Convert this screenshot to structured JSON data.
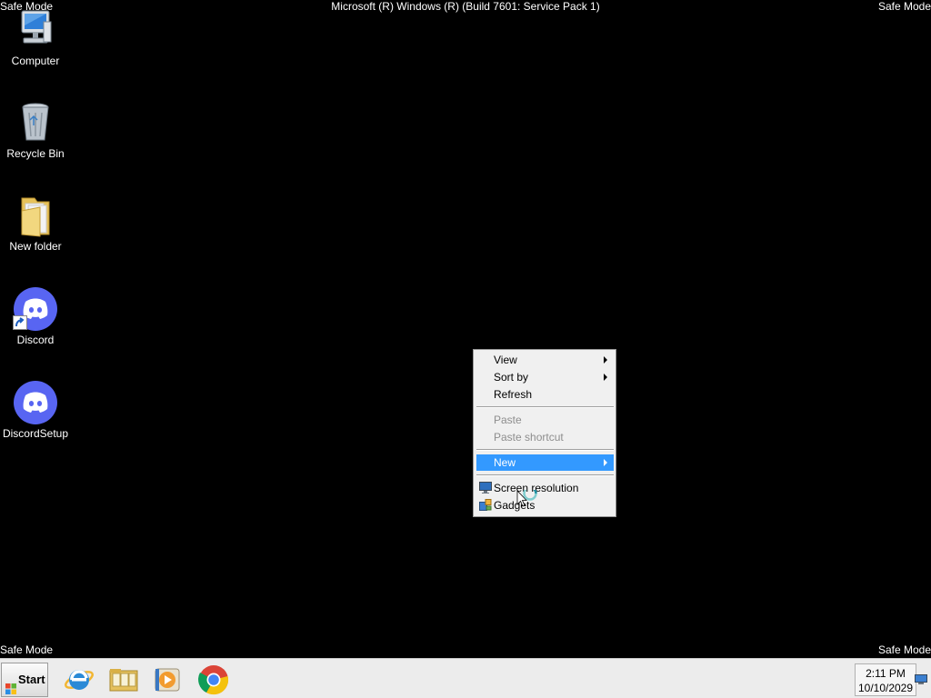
{
  "screen": {
    "safe_mode_labels": [
      "Safe Mode",
      "Safe Mode",
      "Safe Mode",
      "Safe Mode"
    ],
    "build_text": "Microsoft (R) Windows (R) (Build 7601: Service Pack 1)"
  },
  "desktop": {
    "icons": [
      {
        "label": "Computer",
        "icon": "computer-icon"
      },
      {
        "label": "Recycle Bin",
        "icon": "recycle-bin-icon"
      },
      {
        "label": "New folder",
        "icon": "folder-icon"
      },
      {
        "label": "Discord",
        "icon": "discord-icon",
        "shortcut": true
      },
      {
        "label": "DiscordSetup",
        "icon": "discord-icon"
      }
    ]
  },
  "context_menu": {
    "items": [
      {
        "label": "View",
        "submenu": true,
        "enabled": true
      },
      {
        "label": "Sort by",
        "submenu": true,
        "enabled": true
      },
      {
        "label": "Refresh",
        "enabled": true
      },
      {
        "label": "Paste",
        "enabled": false
      },
      {
        "label": "Paste shortcut",
        "enabled": false
      },
      {
        "label": "New",
        "submenu": true,
        "enabled": true,
        "highlighted": true
      },
      {
        "label": "Screen resolution",
        "icon": "monitor-icon",
        "enabled": true
      },
      {
        "label": "Gadgets",
        "icon": "gadgets-icon",
        "enabled": true
      }
    ]
  },
  "taskbar": {
    "start_label": "Start",
    "pinned": [
      {
        "name": "Internet Explorer",
        "icon": "internet-explorer-icon"
      },
      {
        "name": "Windows Explorer",
        "icon": "file-explorer-icon"
      },
      {
        "name": "Windows Media Player",
        "icon": "media-player-icon"
      },
      {
        "name": "Google Chrome",
        "icon": "chrome-icon"
      }
    ],
    "clock": {
      "time": "2:11 PM",
      "date": "10/10/2029"
    }
  },
  "colors": {
    "desktop_bg": "#000000",
    "menu_highlight": "#3399ff",
    "discord": "#5865f2",
    "taskbar": "#ececec"
  }
}
